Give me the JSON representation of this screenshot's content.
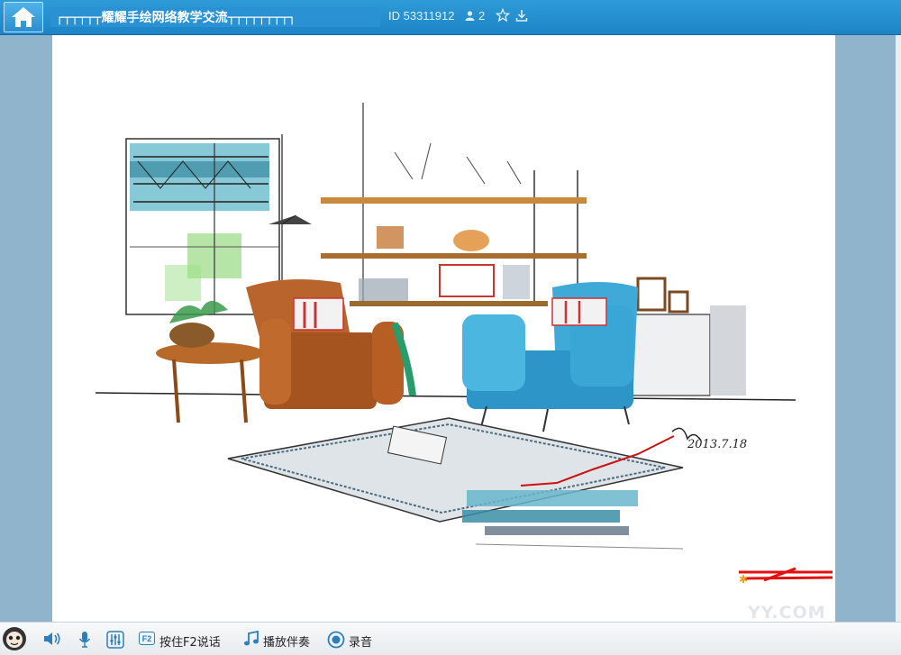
{
  "header": {
    "title": "┌┬┬┬┬┬耀耀手绘网络教学交流┬┬┬┬┬┬┬┬┐",
    "room_id": "ID 53311912",
    "user_count": "2",
    "icons": [
      "home-icon",
      "user-icon",
      "star-icon",
      "download-icon"
    ]
  },
  "content": {
    "watermark": "YY.COM",
    "signature": "2013.7.18"
  },
  "toolbar": {
    "f2_key": "F2",
    "f2_label": "按住F2说话",
    "accompaniment_label": "播放伴奏",
    "record_label": "录音",
    "icons": [
      "speaker-icon",
      "microphone-icon",
      "mixer-icon",
      "music-note-icon",
      "record-icon"
    ]
  },
  "colors": {
    "topbar": "#1d84c6",
    "background": "#8fb4cc",
    "accent_blue": "#2f9bd8"
  }
}
